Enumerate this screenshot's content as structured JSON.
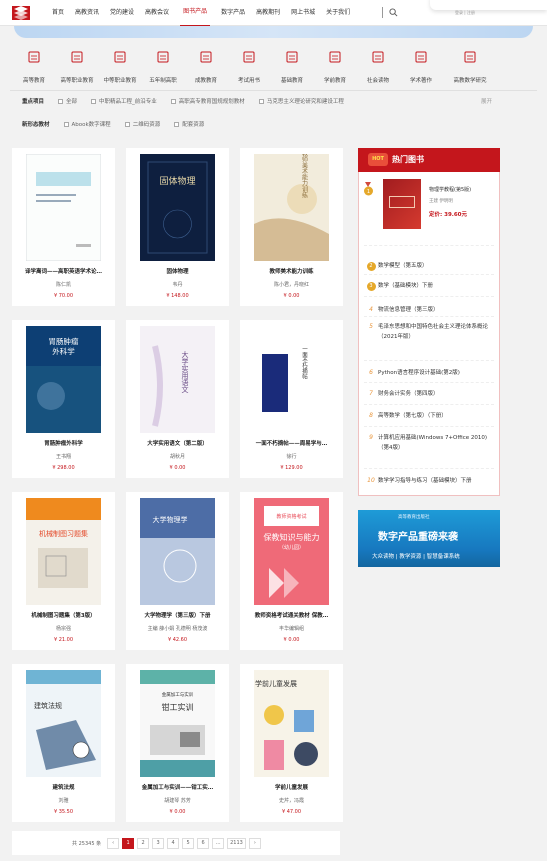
{
  "nav": [
    "首页",
    "高教资讯",
    "党的建设",
    "高教会议",
    "图书产品",
    "数字产品",
    "高教期刊",
    "网上书城",
    "关于我们"
  ],
  "nav_active": 4,
  "user_label": "登录 | 注册",
  "categories": [
    "高等教育",
    "高等职业教育",
    "中等职业教育",
    "五年制高职",
    "成教教育",
    "考试用书",
    "基础教育",
    "学前教育",
    "社会读物",
    "学术著作",
    "高教数学研究"
  ],
  "filters": {
    "row1_label": "重点项目",
    "row1_options": [
      "全部",
      "中职精品工程_前沿专业",
      "高职高专教育国规规划教材",
      "马克思主义理论研究和建设工程"
    ],
    "row2_label": "新形态教材",
    "row2_options": [
      "Abook数字课程",
      "二维码资源",
      "配套资源"
    ],
    "expand": "展开"
  },
  "books": [
    {
      "title": "译学离词——高职英语学术论…",
      "author": "陈仁凯",
      "price": "¥ 70.00",
      "cover": "c1"
    },
    {
      "title": "固体物理",
      "author": "韦丹",
      "price": "¥ 148.00",
      "cover": "c2"
    },
    {
      "title": "教师美术能力训练",
      "author": "陈小君，丹晓红",
      "price": "¥ 0.00",
      "cover": "c3"
    },
    {
      "title": "胃肠肿瘤外科学",
      "author": "王书翔",
      "price": "¥ 298.00",
      "cover": "c4"
    },
    {
      "title": "大学实用语文（第二版）",
      "author": "胡秋月",
      "price": "¥ 0.00",
      "cover": "c5"
    },
    {
      "title": "一面不朽摘帖——周易学与…",
      "author": "徐行",
      "price": "¥ 129.00",
      "cover": "c6"
    },
    {
      "title": "机械制图习题集（第3版）",
      "author": "杨宗强",
      "price": "¥ 21.00",
      "cover": "c7"
    },
    {
      "title": "大学物理学（第三版）下册",
      "author": "主编 薛小娟 孔德明 杨茂波",
      "price": "¥ 42.60",
      "cover": "c8"
    },
    {
      "title": "教师资格考试通关教材 保教…",
      "author": "丰华编辑组",
      "price": "¥ 0.00",
      "cover": "c9"
    },
    {
      "title": "建筑法规",
      "author": "刘雅",
      "price": "¥ 35.50",
      "cover": "c10"
    },
    {
      "title": "金属加工与实训——钳工实…",
      "author": "胡建琴 苏芳",
      "price": "¥ 0.00",
      "cover": "c11"
    },
    {
      "title": "学前儿童发展",
      "author": "史芹，冯霞",
      "price": "¥ 47.00",
      "cover": "c12"
    }
  ],
  "cover_text": {
    "c2": "固体物理",
    "c3": "教师美术能力训练",
    "c4": "胃肠肿瘤外科学",
    "c5": "大学实用语文",
    "c6": "一面不朽摘帖",
    "c7": "机械制图习题集",
    "c8": "大学物理学",
    "c9": "保教知识与能力",
    "c9_sub": "（幼儿园）",
    "c10": "建筑法规",
    "c11": "钳工实训",
    "c11_top": "金属加工与实训",
    "c12": "学前儿童发展"
  },
  "pager": {
    "total": "共 25345 条",
    "pages": [
      "1",
      "2",
      "3",
      "4",
      "5",
      "6",
      "…",
      "2113"
    ],
    "active": 0,
    "prev": "‹",
    "next": "›"
  },
  "hot": {
    "title": "热门图书",
    "badge": "HOT",
    "first": {
      "title": "物理学教程(第5版)",
      "author": "王建 伊明明",
      "price": "定价: 39.60元"
    },
    "items": [
      {
        "rank": "2",
        "text": "数学模型（第五版）"
      },
      {
        "rank": "3",
        "text": "数学（基础模块）下册"
      },
      {
        "rank": "4",
        "text": "物流信息管理（第三版）"
      },
      {
        "rank": "5",
        "text": "毛泽东思想和中国特色社会主义理论体系概论（2021年版）"
      },
      {
        "rank": "6",
        "text": "Python语言程序设计基础(第2版)"
      },
      {
        "rank": "7",
        "text": "财务会计实务（第四版）"
      },
      {
        "rank": "8",
        "text": "高等数学（第七版）（下册）"
      },
      {
        "rank": "9",
        "text": "计算机应用基础(Windows 7+Office 2010)（第4版）"
      },
      {
        "rank": "10",
        "text": "数学学习指导与练习（基础模块）下册"
      }
    ]
  },
  "ad": {
    "headline": "数字产品重磅来袭",
    "sub": "大众读物 | 教学资源 | 智慧备课系统",
    "logo": "高等教育出版社"
  }
}
